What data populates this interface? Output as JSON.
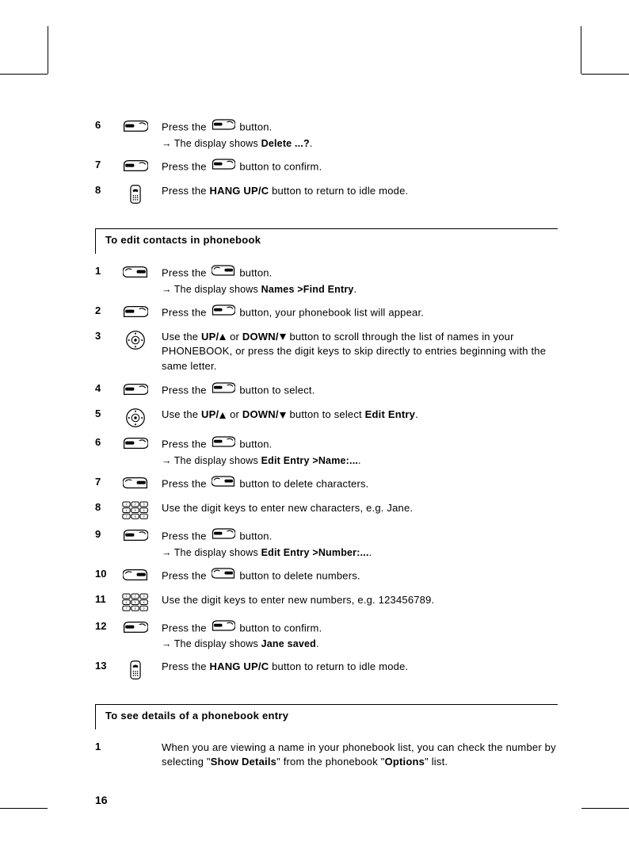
{
  "top": {
    "steps": [
      {
        "num": "6",
        "icon": "left-softkey",
        "text_parts": [
          "Press the ",
          {
            "icon": "left-softkey"
          },
          " button."
        ],
        "sub_parts": [
          {
            "arrow": true
          },
          "The display shows ",
          {
            "bold": "Delete ...?"
          },
          "."
        ]
      },
      {
        "num": "7",
        "icon": "left-softkey",
        "text_parts": [
          "Press the ",
          {
            "icon": "left-softkey"
          },
          " button to confirm."
        ]
      },
      {
        "num": "8",
        "icon": "hangup",
        "text_parts": [
          "Press the ",
          {
            "bold": "HANG UP/C"
          },
          " button to return to idle mode."
        ]
      }
    ]
  },
  "section_edit": {
    "title": "To edit contacts in phonebook",
    "steps": [
      {
        "num": "1",
        "icon": "right-softkey",
        "text_parts": [
          "Press the ",
          {
            "icon": "right-softkey"
          },
          " button."
        ],
        "sub_parts": [
          {
            "arrow": true
          },
          "The display shows ",
          {
            "bold": "Names >Find Entry"
          },
          "."
        ]
      },
      {
        "num": "2",
        "icon": "left-softkey",
        "text_parts": [
          "Press the ",
          {
            "icon": "left-softkey"
          },
          " button, your phonebook list will appear."
        ]
      },
      {
        "num": "3",
        "icon": "nav",
        "text_parts": [
          "Use the ",
          {
            "bold": "UP/"
          },
          {
            "tri": "up"
          },
          " or ",
          {
            "bold": "DOWN/"
          },
          {
            "tri": "down"
          },
          " button to scroll through the list of names in your PHONEBOOK, or press the digit keys to skip directly to entries beginning with the same letter."
        ]
      },
      {
        "num": "4",
        "icon": "left-softkey",
        "text_parts": [
          "Press the ",
          {
            "icon": "left-softkey"
          },
          " button to select."
        ]
      },
      {
        "num": "5",
        "icon": "nav",
        "text_parts": [
          "Use the ",
          {
            "bold": "UP/"
          },
          {
            "tri": "up"
          },
          " or ",
          {
            "bold": "DOWN/"
          },
          {
            "tri": "down"
          },
          " button to select ",
          {
            "bold": "Edit Entry"
          },
          "."
        ]
      },
      {
        "num": "6",
        "icon": "left-softkey",
        "text_parts": [
          "Press the ",
          {
            "icon": "left-softkey"
          },
          " button."
        ],
        "sub_parts": [
          {
            "arrow": true
          },
          "The display shows ",
          {
            "bold": "Edit Entry >Name:..."
          },
          "."
        ]
      },
      {
        "num": "7",
        "icon": "right-softkey",
        "text_parts": [
          "Press the ",
          {
            "icon": "right-softkey"
          },
          " button to delete characters."
        ]
      },
      {
        "num": "8",
        "icon": "keypad",
        "text_parts": [
          "Use the digit keys to enter new characters, e.g. Jane."
        ]
      },
      {
        "num": "9",
        "icon": "left-softkey",
        "text_parts": [
          "Press the ",
          {
            "icon": "left-softkey"
          },
          " button."
        ],
        "sub_parts": [
          {
            "arrow": true
          },
          "The display shows ",
          {
            "bold": "Edit Entry >Number:..."
          },
          "."
        ]
      },
      {
        "num": "10",
        "icon": "right-softkey",
        "text_parts": [
          "Press the ",
          {
            "icon": "right-softkey"
          },
          " button to delete numbers."
        ]
      },
      {
        "num": "11",
        "icon": "keypad",
        "text_parts": [
          "Use the digit keys to enter new numbers, e.g. 123456789."
        ]
      },
      {
        "num": "12",
        "icon": "left-softkey",
        "text_parts": [
          "Press the ",
          {
            "icon": "left-softkey"
          },
          " button to confirm."
        ],
        "sub_parts": [
          {
            "arrow": true
          },
          "The display shows ",
          {
            "bold": "Jane saved"
          },
          "."
        ]
      },
      {
        "num": "13",
        "icon": "hangup",
        "text_parts": [
          "Press the ",
          {
            "bold": "HANG UP/C"
          },
          " button to return to idle mode."
        ]
      }
    ]
  },
  "section_details": {
    "title": "To see details of a phonebook entry",
    "steps": [
      {
        "num": "1",
        "icon": "none",
        "text_parts": [
          "When you are viewing a name in your phonebook list, you can check the number by selecting \"",
          {
            "bold": "Show Details"
          },
          "\" from the phonebook \"",
          {
            "bold": "Options"
          },
          "\" list."
        ]
      }
    ]
  },
  "page_number": "16"
}
